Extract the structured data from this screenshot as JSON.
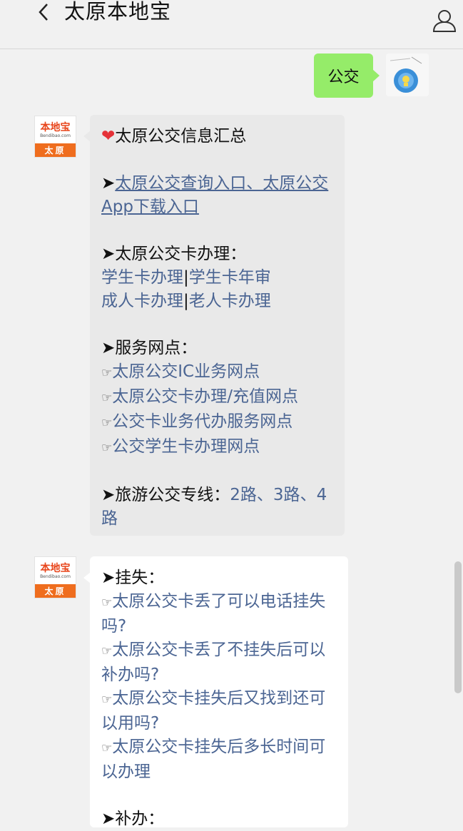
{
  "header": {
    "title": "太原本地宝",
    "back_icon": "chevron-left-icon",
    "profile_icon": "person-icon"
  },
  "my_message": {
    "text": "公交"
  },
  "avatar_logo": {
    "main": "本地宝",
    "sub": "Bendibao.com",
    "city": "太原"
  },
  "bubble1": {
    "heading_icon": "❤",
    "heading": "太原公交信息汇总",
    "arrow": "➤",
    "query_link": "太原公交查询入口、太原公交App下载入口",
    "card_title": "太原公交卡办理：",
    "card_links": {
      "student_card": "学生卡办理",
      "student_review": "学生卡年审",
      "adult_card": "成人卡办理",
      "senior_card": "老人卡办理",
      "divider": "|"
    },
    "service_title": "服务网点：",
    "hand": "☞",
    "service_links": [
      "太原公交IC业务网点",
      "太原公交卡办理/充值网点",
      "公交卡业务代办服务网点",
      "公交学生卡办理网点"
    ],
    "tour_title": "旅游公交专线：",
    "tour_links": [
      "2路",
      "3路",
      "4路"
    ],
    "tour_sep": "、"
  },
  "bubble2": {
    "arrow": "➤",
    "loss_title": "挂失：",
    "hand": "☞",
    "loss_links": [
      "太原公交卡丢了可以电话挂失吗?",
      "太原公交卡丢了不挂失后可以补办吗?",
      "太原公交卡挂失后又找到还可以用吗?",
      "太原公交卡挂失后多长时间可以办理"
    ],
    "replace_title": "补办："
  },
  "colors": {
    "background": "#f1f1f1",
    "my_bubble": "#95ec69",
    "link": "#4b6593",
    "logo_orange": "#ef6d1e"
  }
}
